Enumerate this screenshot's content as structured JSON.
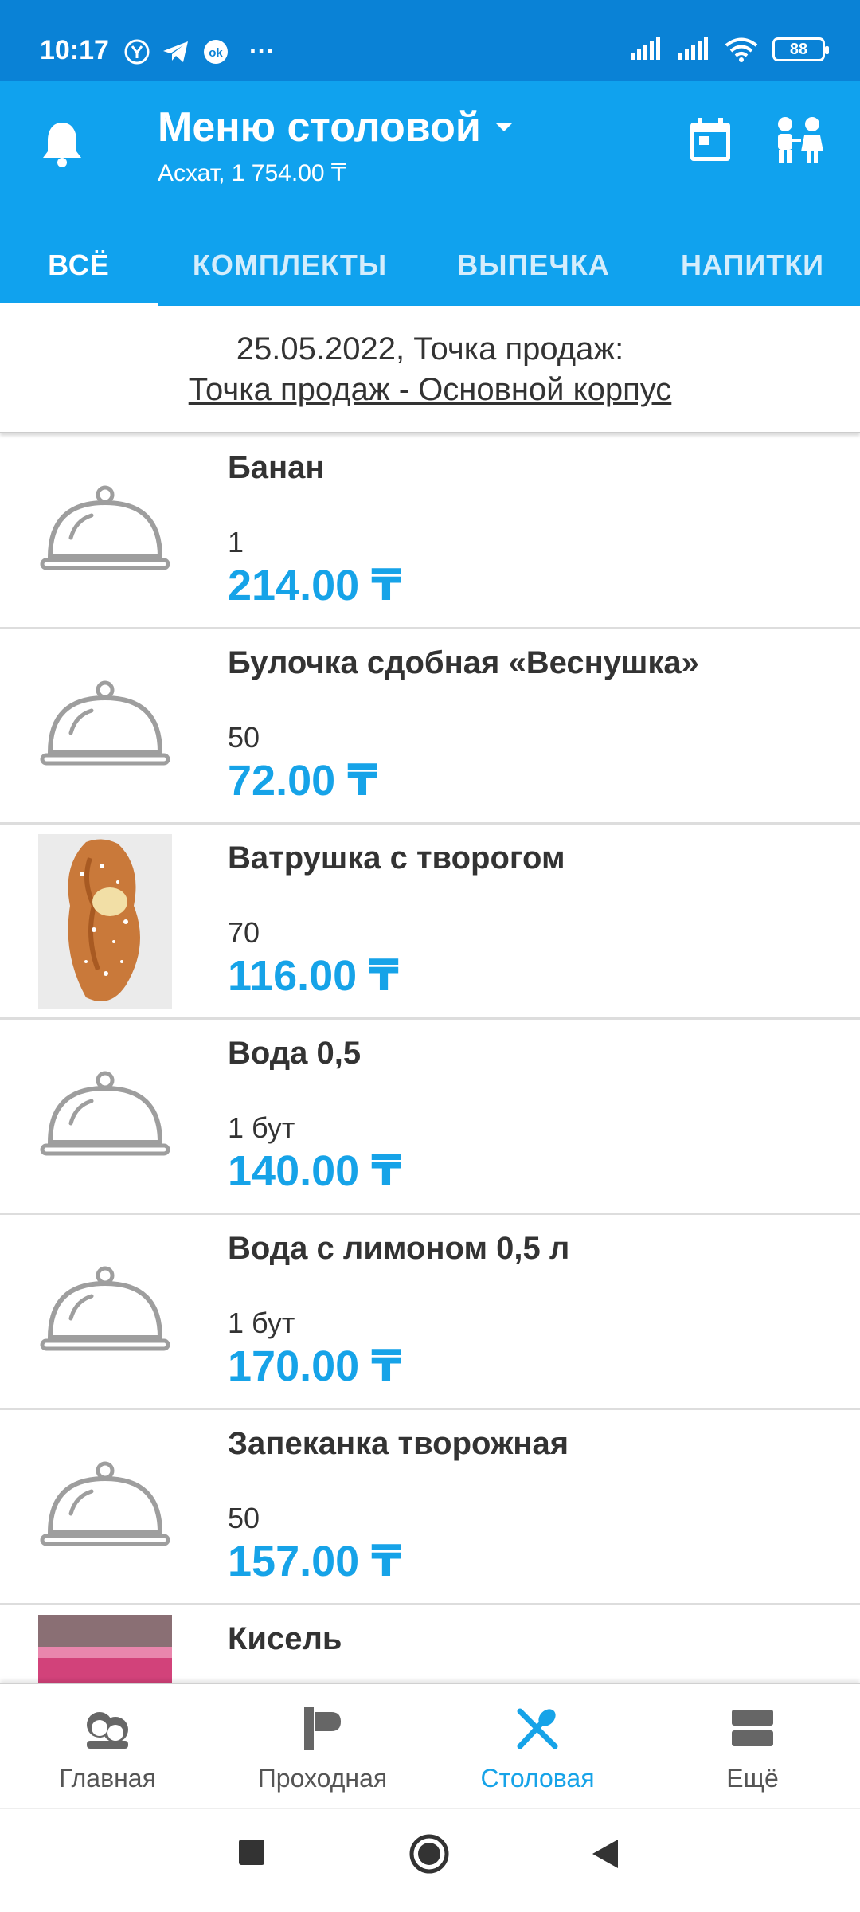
{
  "status_bar": {
    "time": "10:17",
    "battery": "88",
    "more_indicator": "···"
  },
  "header": {
    "title": "Меню столовой",
    "subtitle": "Асхат, 1 754.00 ₸",
    "accent_color": "#10a2ee"
  },
  "tabs": [
    {
      "label": "ВСЁ",
      "active": true
    },
    {
      "label": "КОМПЛЕКТЫ",
      "active": false
    },
    {
      "label": "ВЫПЕЧКА",
      "active": false
    },
    {
      "label": "НАПИТКИ",
      "active": false
    }
  ],
  "date_bar": {
    "date_line": "25.05.2022, Точка продаж:",
    "location": "Точка продаж - Основной корпус"
  },
  "items": [
    {
      "name": "Банан",
      "portion": "1",
      "price": "214.00 ₸",
      "thumb": "cloche-icon"
    },
    {
      "name": "Булочка сдобная «Веснушка»",
      "portion": "50",
      "price": "72.00 ₸",
      "thumb": "cloche-icon"
    },
    {
      "name": "Ватрушка с творогом",
      "portion": "70",
      "price": "116.00 ₸",
      "thumb": "pastry-photo"
    },
    {
      "name": "Вода 0,5",
      "portion": "1 бут",
      "price": "140.00 ₸",
      "thumb": "cloche-icon"
    },
    {
      "name": "Вода с лимоном 0,5 л",
      "portion": "1 бут",
      "price": "170.00 ₸",
      "thumb": "cloche-icon"
    },
    {
      "name": "Запеканка  творожная",
      "portion": "50",
      "price": "157.00 ₸",
      "thumb": "cloche-icon"
    },
    {
      "name": "Кисель",
      "portion": "",
      "price": "",
      "thumb": "drink-photo"
    }
  ],
  "bottom_nav": [
    {
      "label": "Главная",
      "icon": "children-faces-icon",
      "active": false
    },
    {
      "label": "Проходная",
      "icon": "turnstile-icon",
      "active": false
    },
    {
      "label": "Столовая",
      "icon": "fork-spoon-icon",
      "active": true
    },
    {
      "label": "Ещё",
      "icon": "more-icon",
      "active": false
    }
  ]
}
